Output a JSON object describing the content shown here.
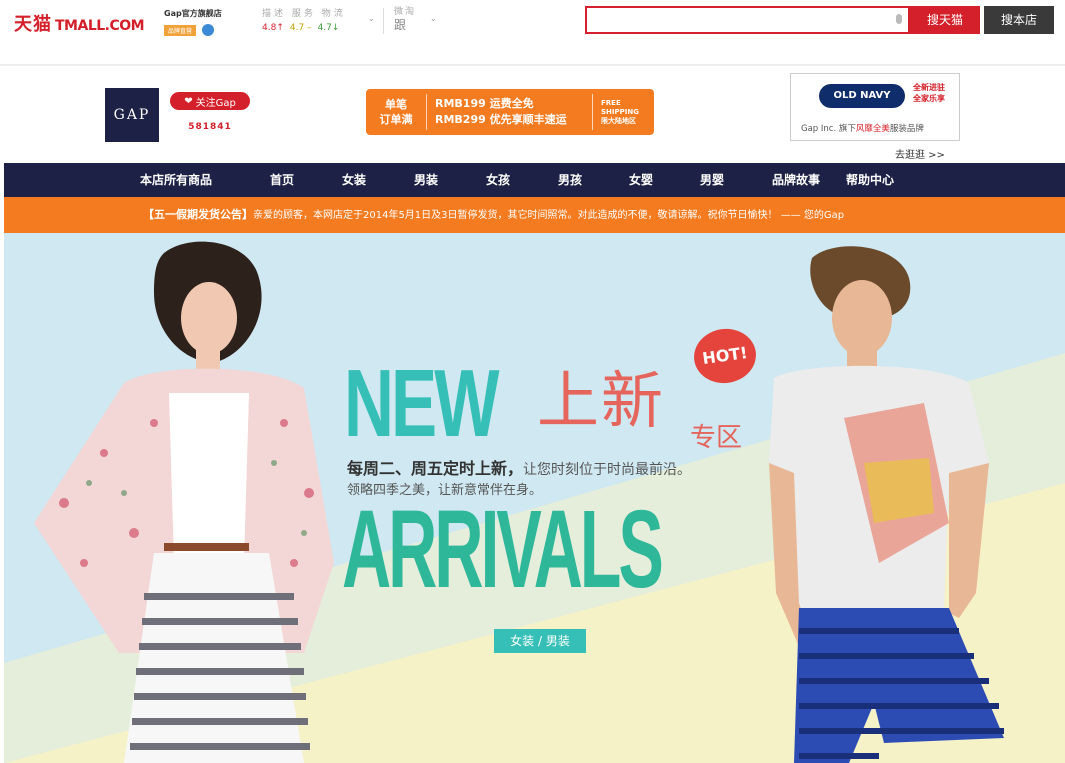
{
  "header": {
    "logo_cn": "天猫",
    "logo_en": "TMALL.COM",
    "shop_name": "Gap官方旗舰店",
    "shop_badge": "品牌直营",
    "ratings_labels": "描述 服务 物流",
    "ratings": [
      {
        "value": "4.8",
        "arrow": "↑"
      },
      {
        "value": "4.7",
        "arrow": "–"
      },
      {
        "value": "4.7",
        "arrow": "↓"
      }
    ],
    "weitao_label": "微淘",
    "weitao_icon_text": "跟",
    "caret": "⌄",
    "search_placeholder": "",
    "search_tmall_label": "搜天猫",
    "search_shop_label": "搜本店"
  },
  "shop": {
    "brand_logo": "GAP",
    "follow_label": "关注Gap",
    "follow_count": "581841",
    "promo": {
      "left_line1": "单笔",
      "left_line2": "订单满",
      "mid_line1": "RMB199 运费全免",
      "mid_line2": "RMB299 优先享顺丰速运",
      "right_line1": "FREE",
      "right_line2": "SHIPPING",
      "right_line3": "限大陆地区"
    },
    "old_navy": {
      "logo": "OLD NAVY",
      "tag_line1": "全新进驻",
      "tag_line2": "全家乐享",
      "desc_prefix": "Gap Inc. 旗下",
      "desc_red": "风靡全美",
      "desc_suffix": "服装品牌"
    },
    "go_shop": "去逛逛  >>"
  },
  "nav": {
    "items": [
      "本店所有商品",
      "首页",
      "女装",
      "男装",
      "女孩",
      "男孩",
      "女婴",
      "男婴",
      "品牌故事",
      "帮助中心"
    ]
  },
  "notice": {
    "highlight": "【五一假期发货公告】",
    "text": "亲爱的顾客，本网店定于2014年5月1日及3日暂停发货，其它时间照常。对此造成的不便，敬请谅解。祝你节日愉快！ —— 您的Gap"
  },
  "banner": {
    "new": "NEW",
    "new_cn": "上新",
    "zone": "专区",
    "hot": "HOT!",
    "line1_bold": "每周二、周五定时上新，",
    "line1_rest": "让您时刻位于时尚最前沿。",
    "line2": "领略四季之美，让新意常伴在身。",
    "arrivals": "ARRIVALS",
    "category_tag": "女装 / 男装",
    "colors": {
      "sky": "#cfe8f1",
      "cream": "#f6f2c8",
      "teal": "#35bfb6",
      "green": "#2fb79a",
      "coral": "#e5645c"
    }
  }
}
